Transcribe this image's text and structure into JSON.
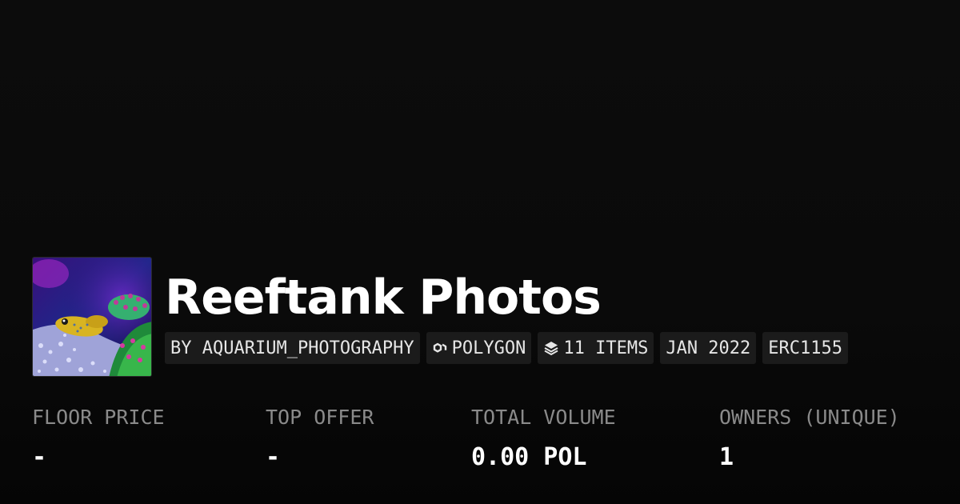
{
  "collection": {
    "title": "Reeftank Photos",
    "thumbnail_icon": "reef-aquarium-photo"
  },
  "tags": [
    {
      "label": "BY AQUARIUM_PHOTOGRAPHY"
    },
    {
      "label": "POLYGON",
      "icon": "chain-link-icon"
    },
    {
      "label": "11 ITEMS",
      "icon": "layers-icon"
    },
    {
      "label": "JAN 2022"
    },
    {
      "label": "ERC1155"
    }
  ],
  "stats": [
    {
      "label": "FLOOR PRICE",
      "value": "-"
    },
    {
      "label": "TOP OFFER",
      "value": "-"
    },
    {
      "label": "TOTAL VOLUME",
      "value": "0.00 POL"
    },
    {
      "label": "OWNERS (UNIQUE)",
      "value": "1"
    }
  ],
  "colors": {
    "background": "#0a0a0a",
    "tag_background": "#1b1b1b",
    "label_gray": "#8a8a8a",
    "text": "#ffffff"
  }
}
